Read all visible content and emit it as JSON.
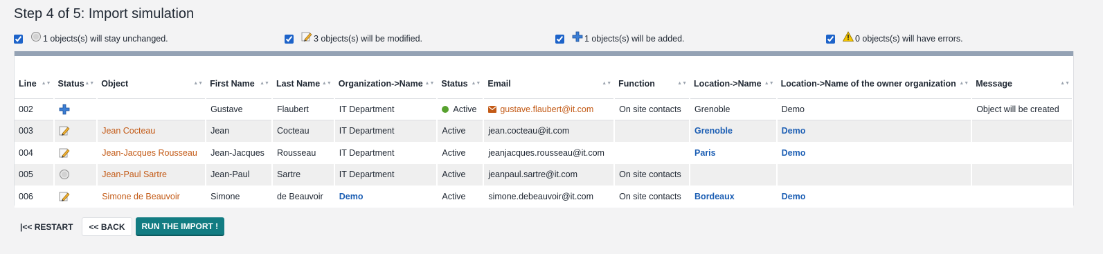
{
  "page": {
    "title": "Step 4 of 5: Import simulation"
  },
  "summary": {
    "unchanged": {
      "label": "1 objects(s) will stay unchanged.",
      "icon": "unchanged-circle-icon",
      "checked": true
    },
    "modified": {
      "label": "3 objects(s) will be modified.",
      "icon": "pencil-edit-icon",
      "checked": true
    },
    "added": {
      "label": "1 objects(s) will be added.",
      "icon": "blue-plus-icon",
      "checked": true
    },
    "errors": {
      "label": "0 objects(s) will have errors.",
      "icon": "warning-triangle-icon",
      "checked": true
    }
  },
  "table": {
    "headers": [
      "Line",
      "Status",
      "Object",
      "First Name",
      "Last Name",
      "Organization->Name",
      "Status",
      "Email",
      "Function",
      "Location->Name",
      "Location->Name of the owner organization",
      "Message"
    ],
    "rows": [
      {
        "line": "002",
        "status_icon": "blue-plus-icon",
        "object": "",
        "first_name": "Gustave",
        "last_name": "Flaubert",
        "org": "IT Department",
        "status": "Active",
        "email": "gustave.flaubert@it.com",
        "function": "On site contacts",
        "location": "Grenoble",
        "owner_org": "Demo",
        "message": "Object will be created"
      },
      {
        "line": "003",
        "status_icon": "pencil-edit-icon",
        "object": "Jean Cocteau",
        "first_name": "Jean",
        "last_name": "Cocteau",
        "org": "IT Department",
        "status": "Active",
        "email": "jean.cocteau@it.com",
        "function": "",
        "location": "Grenoble",
        "owner_org": "Demo",
        "message": ""
      },
      {
        "line": "004",
        "status_icon": "pencil-edit-icon",
        "object": "Jean-Jacques Rousseau",
        "first_name": "Jean-Jacques",
        "last_name": "Rousseau",
        "org": "IT Department",
        "status": "Active",
        "email": "jeanjacques.rousseau@it.com",
        "function": "",
        "location": "Paris",
        "owner_org": "Demo",
        "message": ""
      },
      {
        "line": "005",
        "status_icon": "unchanged-circle-icon",
        "object": "Jean-Paul Sartre",
        "first_name": "Jean-Paul",
        "last_name": "Sartre",
        "org": "IT Department",
        "status": "Active",
        "email": "jeanpaul.sartre@it.com",
        "function": "On site contacts",
        "location": "",
        "owner_org": "",
        "message": ""
      },
      {
        "line": "006",
        "status_icon": "pencil-edit-icon",
        "object": "Simone de Beauvoir",
        "first_name": "Simone",
        "last_name": "de Beauvoir",
        "org": "Demo",
        "status": "Active",
        "email": "simone.debeauvoir@it.com",
        "function": "On site contacts",
        "location": "Bordeaux",
        "owner_org": "Demo",
        "message": ""
      }
    ]
  },
  "actions": {
    "restart": "|<< RESTART",
    "back": "<< BACK",
    "run": "RUN THE IMPORT !"
  },
  "colors": {
    "accent_teal": "#127c82",
    "link_orange": "#c35a16",
    "link_blue": "#1d5fb4",
    "active_green": "#57a12e",
    "panel_bar": "#94a2b4"
  }
}
